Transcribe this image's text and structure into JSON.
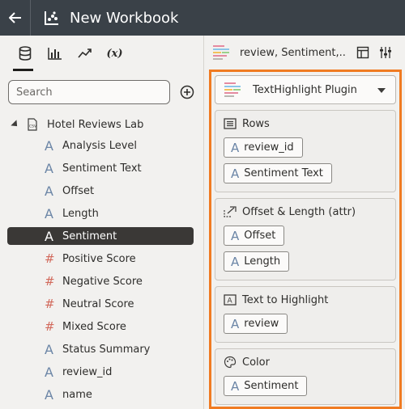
{
  "header": {
    "title": "New Workbook"
  },
  "search": {
    "placeholder": "Search"
  },
  "source": {
    "name": "Hotel Reviews Lab"
  },
  "columns": [
    {
      "label": "Analysis Level",
      "type": "attr"
    },
    {
      "label": "Sentiment Text",
      "type": "attr"
    },
    {
      "label": "Offset",
      "type": "attr"
    },
    {
      "label": "Length",
      "type": "attr"
    },
    {
      "label": "Sentiment",
      "type": "attr",
      "selected": true
    },
    {
      "label": "Positive Score",
      "type": "measure"
    },
    {
      "label": "Negative Score",
      "type": "measure"
    },
    {
      "label": "Neutral Score",
      "type": "measure"
    },
    {
      "label": "Mixed Score",
      "type": "measure"
    },
    {
      "label": "Status Summary",
      "type": "attr"
    },
    {
      "label": "review_id",
      "type": "attr"
    },
    {
      "label": "name",
      "type": "attr"
    }
  ],
  "viz": {
    "header_text": "review, Sentiment,...",
    "plugin": "TextHighlight Plugin",
    "sections": {
      "rows": {
        "title": "Rows",
        "items": [
          "review_id",
          "Sentiment Text"
        ]
      },
      "offset": {
        "title": "Offset & Length (attr)",
        "items": [
          "Offset",
          "Length"
        ]
      },
      "text": {
        "title": "Text to Highlight",
        "items": [
          "review"
        ]
      },
      "color": {
        "title": "Color",
        "items": [
          "Sentiment"
        ]
      }
    }
  },
  "colors": {
    "accent_border": "#f07b22",
    "topbar": "#3a4148",
    "attr_glyph": "#6b85a6",
    "measure_glyph": "#d26a5c"
  }
}
